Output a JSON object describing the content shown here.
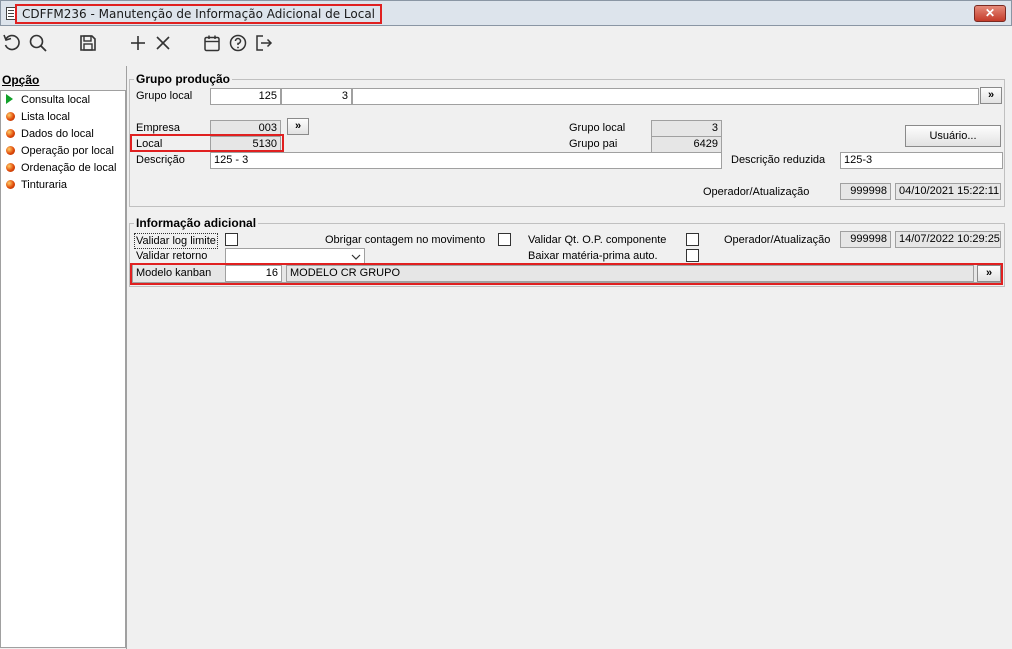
{
  "window": {
    "title": "CDFFM236 - Manutenção de Informação Adicional de Local",
    "close_label": "✕"
  },
  "toolbar": {
    "icons": [
      "refresh-icon",
      "search-icon",
      "save-icon",
      "add-icon",
      "delete-icon",
      "calendar-icon",
      "help-icon",
      "exit-icon"
    ]
  },
  "sidebar": {
    "header": "Opção",
    "items": [
      {
        "label": "Consulta local",
        "icon": "green-arrow-icon"
      },
      {
        "label": "Lista local",
        "icon": "red-dot-icon"
      },
      {
        "label": "Dados do local",
        "icon": "red-dot-icon"
      },
      {
        "label": "Operação por local",
        "icon": "red-dot-icon"
      },
      {
        "label": "Ordenação de local",
        "icon": "red-dot-icon"
      },
      {
        "label": "Tinturaria",
        "icon": "red-dot-icon"
      }
    ]
  },
  "grupo_producao": {
    "title": "Grupo produção",
    "grupo_local_label": "Grupo local",
    "grupo_local_value1": "125",
    "grupo_local_value2": "3",
    "lookup_label": "»",
    "empresa_label": "Empresa",
    "empresa_value": "003",
    "local_label": "Local",
    "local_value": "5130",
    "grupo_local2_label": "Grupo local",
    "grupo_local2_value": "3",
    "grupo_pai_label": "Grupo pai",
    "grupo_pai_value": "6429",
    "usuario_button": "Usuário...",
    "descricao_label": "Descrição",
    "descricao_value": "125 - 3",
    "descricao_reduzida_label": "Descrição reduzida",
    "descricao_reduzida_value": "125-3",
    "operador_label": "Operador/Atualização",
    "operador_value": "999998",
    "atualizacao_value": "04/10/2021 15:22:11"
  },
  "info_adicional": {
    "title": "Informação adicional",
    "validar_log_label": "Validar log limite",
    "obrigar_contagem_label": "Obrigar contagem no movimento",
    "validar_qt_label": "Validar Qt. O.P. componente",
    "operador_label": "Operador/Atualização",
    "operador_value": "999998",
    "atualizacao_value": "14/07/2022 10:29:25",
    "validar_retorno_label": "Validar retorno",
    "validar_retorno_value": "",
    "baixar_materia_label": "Baixar matéria-prima auto.",
    "modelo_kanban_label": "Modelo kanban",
    "modelo_kanban_code": "16",
    "modelo_kanban_desc": "MODELO CR GRUPO",
    "lookup_label": "»"
  }
}
